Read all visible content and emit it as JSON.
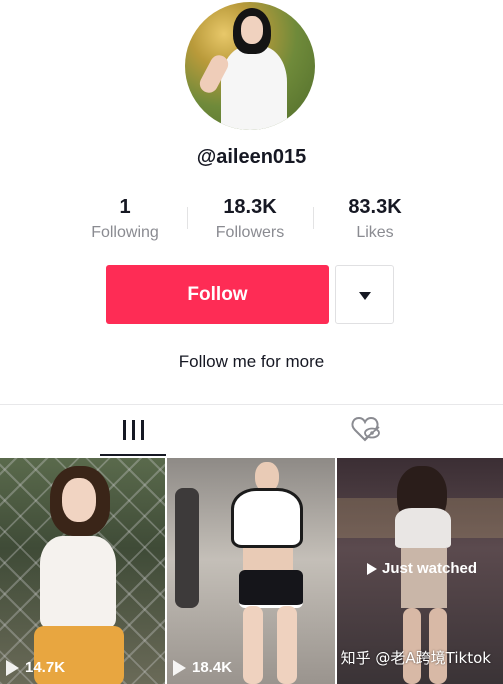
{
  "profile": {
    "username": "@aileen015",
    "bio": "Follow me for more"
  },
  "stats": [
    {
      "value": "1",
      "label": "Following"
    },
    {
      "value": "18.3K",
      "label": "Followers"
    },
    {
      "value": "83.3K",
      "label": "Likes"
    }
  ],
  "actions": {
    "follow_label": "Follow",
    "more_icon": "caret-down-icon"
  },
  "tabs": {
    "videos_icon": "grid-bars-icon",
    "liked_icon": "liked-hidden-heart-icon"
  },
  "videos": [
    {
      "plays": "14.7K"
    },
    {
      "plays": "18.4K"
    },
    {
      "overlay": "Just watched"
    }
  ],
  "watermark": "知乎 @老A跨境Tiktok",
  "colors": {
    "accent": "#fe2c55",
    "text": "#161823",
    "muted": "#8a8b91"
  }
}
